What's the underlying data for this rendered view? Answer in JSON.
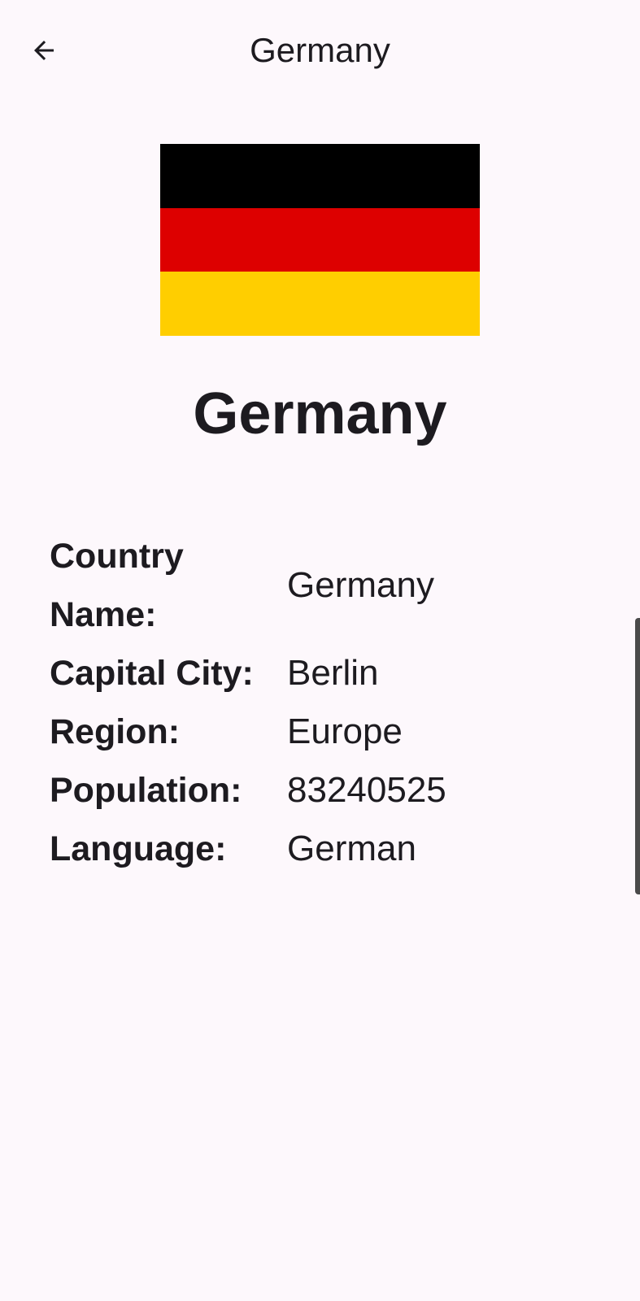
{
  "app_bar": {
    "back_icon": "arrow-back-icon",
    "title": "Germany"
  },
  "flag": {
    "colors": [
      "#000000",
      "#DD0000",
      "#FFCE00"
    ]
  },
  "country": {
    "heading": "Germany"
  },
  "details": [
    {
      "label": "Country Name:",
      "value": "Germany"
    },
    {
      "label": "Capital City:",
      "value": "Berlin"
    },
    {
      "label": "Region:",
      "value": "Europe"
    },
    {
      "label": "Population:",
      "value": "83240525"
    },
    {
      "label": "Language:",
      "value": "German"
    }
  ]
}
